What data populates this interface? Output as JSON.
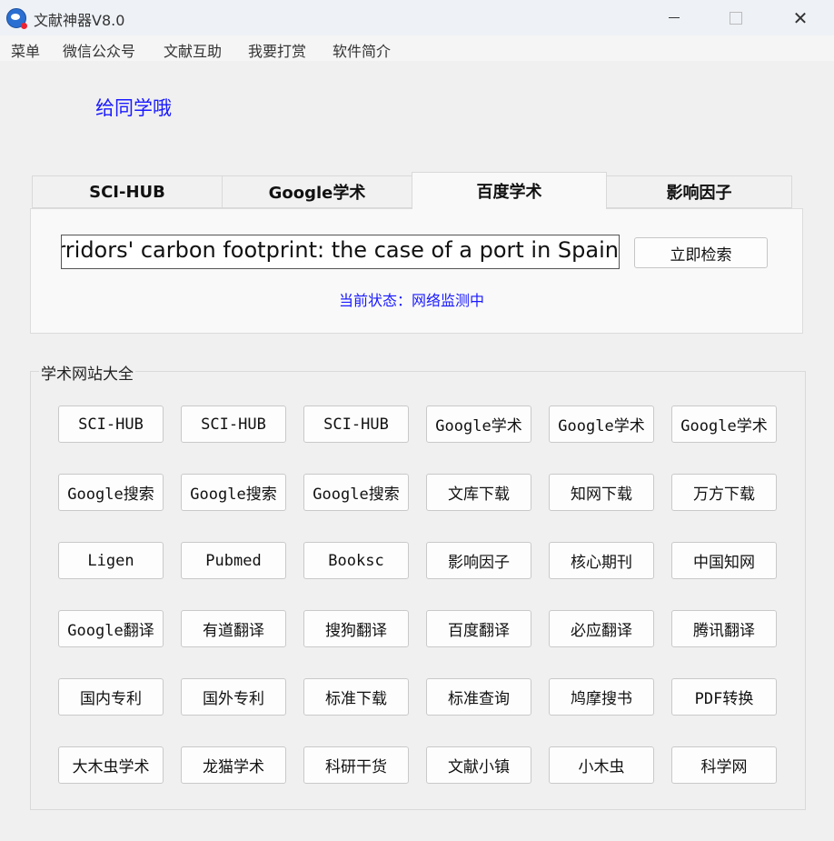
{
  "window": {
    "title": "文献神器V8.0"
  },
  "menu": [
    "菜单",
    "微信公众号",
    "文献互助",
    "我要打赏",
    "软件简介"
  ],
  "notice": "给同学哦",
  "tabs": [
    {
      "label": "SCI-HUB"
    },
    {
      "label": "Google学术"
    },
    {
      "label": "百度学术",
      "active": true
    },
    {
      "label": "影响因子"
    }
  ],
  "search": {
    "value": "corridors' carbon footprint: the case of a port in Spain",
    "button": "立即检索"
  },
  "status": "当前状态：网络监测中",
  "group": {
    "title": "学术网站大全",
    "buttons": [
      [
        "SCI-HUB",
        "SCI-HUB",
        "SCI-HUB",
        "Google学术",
        "Google学术",
        "Google学术"
      ],
      [
        "Google搜索",
        "Google搜索",
        "Google搜索",
        "文库下载",
        "知网下载",
        "万方下载"
      ],
      [
        "Ligen",
        "Pubmed",
        "Booksc",
        "影响因子",
        "核心期刊",
        "中国知网"
      ],
      [
        "Google翻译",
        "有道翻译",
        "搜狗翻译",
        "百度翻译",
        "必应翻译",
        "腾讯翻译"
      ],
      [
        "国内专利",
        "国外专利",
        "标准下载",
        "标准查询",
        "鸠摩搜书",
        "PDF转换"
      ],
      [
        "大木虫学术",
        "龙猫学术",
        "科研干货",
        "文献小镇",
        "小木虫",
        "科学网"
      ]
    ]
  }
}
